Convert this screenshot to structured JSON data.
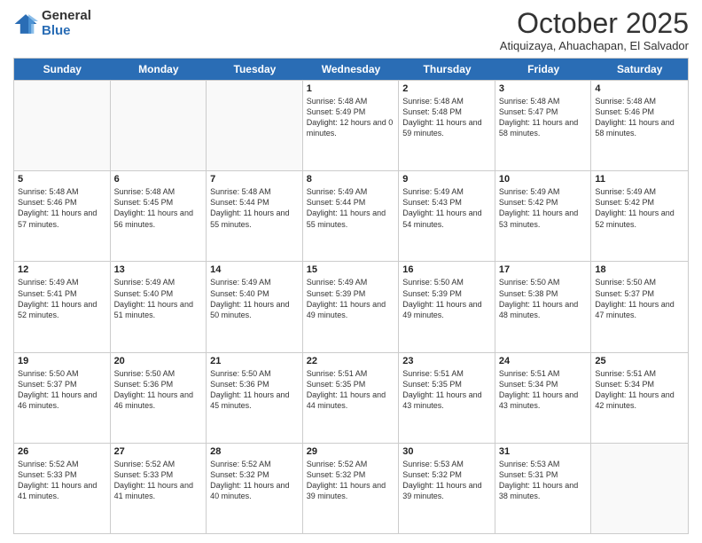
{
  "logo": {
    "general": "General",
    "blue": "Blue"
  },
  "header": {
    "month": "October 2025",
    "location": "Atiquizaya, Ahuachapan, El Salvador"
  },
  "weekdays": [
    "Sunday",
    "Monday",
    "Tuesday",
    "Wednesday",
    "Thursday",
    "Friday",
    "Saturday"
  ],
  "rows": [
    [
      {
        "day": "",
        "sunrise": "",
        "sunset": "",
        "daylight": ""
      },
      {
        "day": "",
        "sunrise": "",
        "sunset": "",
        "daylight": ""
      },
      {
        "day": "",
        "sunrise": "",
        "sunset": "",
        "daylight": ""
      },
      {
        "day": "1",
        "sunrise": "Sunrise: 5:48 AM",
        "sunset": "Sunset: 5:49 PM",
        "daylight": "Daylight: 12 hours and 0 minutes."
      },
      {
        "day": "2",
        "sunrise": "Sunrise: 5:48 AM",
        "sunset": "Sunset: 5:48 PM",
        "daylight": "Daylight: 11 hours and 59 minutes."
      },
      {
        "day": "3",
        "sunrise": "Sunrise: 5:48 AM",
        "sunset": "Sunset: 5:47 PM",
        "daylight": "Daylight: 11 hours and 58 minutes."
      },
      {
        "day": "4",
        "sunrise": "Sunrise: 5:48 AM",
        "sunset": "Sunset: 5:46 PM",
        "daylight": "Daylight: 11 hours and 58 minutes."
      }
    ],
    [
      {
        "day": "5",
        "sunrise": "Sunrise: 5:48 AM",
        "sunset": "Sunset: 5:46 PM",
        "daylight": "Daylight: 11 hours and 57 minutes."
      },
      {
        "day": "6",
        "sunrise": "Sunrise: 5:48 AM",
        "sunset": "Sunset: 5:45 PM",
        "daylight": "Daylight: 11 hours and 56 minutes."
      },
      {
        "day": "7",
        "sunrise": "Sunrise: 5:48 AM",
        "sunset": "Sunset: 5:44 PM",
        "daylight": "Daylight: 11 hours and 55 minutes."
      },
      {
        "day": "8",
        "sunrise": "Sunrise: 5:49 AM",
        "sunset": "Sunset: 5:44 PM",
        "daylight": "Daylight: 11 hours and 55 minutes."
      },
      {
        "day": "9",
        "sunrise": "Sunrise: 5:49 AM",
        "sunset": "Sunset: 5:43 PM",
        "daylight": "Daylight: 11 hours and 54 minutes."
      },
      {
        "day": "10",
        "sunrise": "Sunrise: 5:49 AM",
        "sunset": "Sunset: 5:42 PM",
        "daylight": "Daylight: 11 hours and 53 minutes."
      },
      {
        "day": "11",
        "sunrise": "Sunrise: 5:49 AM",
        "sunset": "Sunset: 5:42 PM",
        "daylight": "Daylight: 11 hours and 52 minutes."
      }
    ],
    [
      {
        "day": "12",
        "sunrise": "Sunrise: 5:49 AM",
        "sunset": "Sunset: 5:41 PM",
        "daylight": "Daylight: 11 hours and 52 minutes."
      },
      {
        "day": "13",
        "sunrise": "Sunrise: 5:49 AM",
        "sunset": "Sunset: 5:40 PM",
        "daylight": "Daylight: 11 hours and 51 minutes."
      },
      {
        "day": "14",
        "sunrise": "Sunrise: 5:49 AM",
        "sunset": "Sunset: 5:40 PM",
        "daylight": "Daylight: 11 hours and 50 minutes."
      },
      {
        "day": "15",
        "sunrise": "Sunrise: 5:49 AM",
        "sunset": "Sunset: 5:39 PM",
        "daylight": "Daylight: 11 hours and 49 minutes."
      },
      {
        "day": "16",
        "sunrise": "Sunrise: 5:50 AM",
        "sunset": "Sunset: 5:39 PM",
        "daylight": "Daylight: 11 hours and 49 minutes."
      },
      {
        "day": "17",
        "sunrise": "Sunrise: 5:50 AM",
        "sunset": "Sunset: 5:38 PM",
        "daylight": "Daylight: 11 hours and 48 minutes."
      },
      {
        "day": "18",
        "sunrise": "Sunrise: 5:50 AM",
        "sunset": "Sunset: 5:37 PM",
        "daylight": "Daylight: 11 hours and 47 minutes."
      }
    ],
    [
      {
        "day": "19",
        "sunrise": "Sunrise: 5:50 AM",
        "sunset": "Sunset: 5:37 PM",
        "daylight": "Daylight: 11 hours and 46 minutes."
      },
      {
        "day": "20",
        "sunrise": "Sunrise: 5:50 AM",
        "sunset": "Sunset: 5:36 PM",
        "daylight": "Daylight: 11 hours and 46 minutes."
      },
      {
        "day": "21",
        "sunrise": "Sunrise: 5:50 AM",
        "sunset": "Sunset: 5:36 PM",
        "daylight": "Daylight: 11 hours and 45 minutes."
      },
      {
        "day": "22",
        "sunrise": "Sunrise: 5:51 AM",
        "sunset": "Sunset: 5:35 PM",
        "daylight": "Daylight: 11 hours and 44 minutes."
      },
      {
        "day": "23",
        "sunrise": "Sunrise: 5:51 AM",
        "sunset": "Sunset: 5:35 PM",
        "daylight": "Daylight: 11 hours and 43 minutes."
      },
      {
        "day": "24",
        "sunrise": "Sunrise: 5:51 AM",
        "sunset": "Sunset: 5:34 PM",
        "daylight": "Daylight: 11 hours and 43 minutes."
      },
      {
        "day": "25",
        "sunrise": "Sunrise: 5:51 AM",
        "sunset": "Sunset: 5:34 PM",
        "daylight": "Daylight: 11 hours and 42 minutes."
      }
    ],
    [
      {
        "day": "26",
        "sunrise": "Sunrise: 5:52 AM",
        "sunset": "Sunset: 5:33 PM",
        "daylight": "Daylight: 11 hours and 41 minutes."
      },
      {
        "day": "27",
        "sunrise": "Sunrise: 5:52 AM",
        "sunset": "Sunset: 5:33 PM",
        "daylight": "Daylight: 11 hours and 41 minutes."
      },
      {
        "day": "28",
        "sunrise": "Sunrise: 5:52 AM",
        "sunset": "Sunset: 5:32 PM",
        "daylight": "Daylight: 11 hours and 40 minutes."
      },
      {
        "day": "29",
        "sunrise": "Sunrise: 5:52 AM",
        "sunset": "Sunset: 5:32 PM",
        "daylight": "Daylight: 11 hours and 39 minutes."
      },
      {
        "day": "30",
        "sunrise": "Sunrise: 5:53 AM",
        "sunset": "Sunset: 5:32 PM",
        "daylight": "Daylight: 11 hours and 39 minutes."
      },
      {
        "day": "31",
        "sunrise": "Sunrise: 5:53 AM",
        "sunset": "Sunset: 5:31 PM",
        "daylight": "Daylight: 11 hours and 38 minutes."
      },
      {
        "day": "",
        "sunrise": "",
        "sunset": "",
        "daylight": ""
      }
    ]
  ]
}
